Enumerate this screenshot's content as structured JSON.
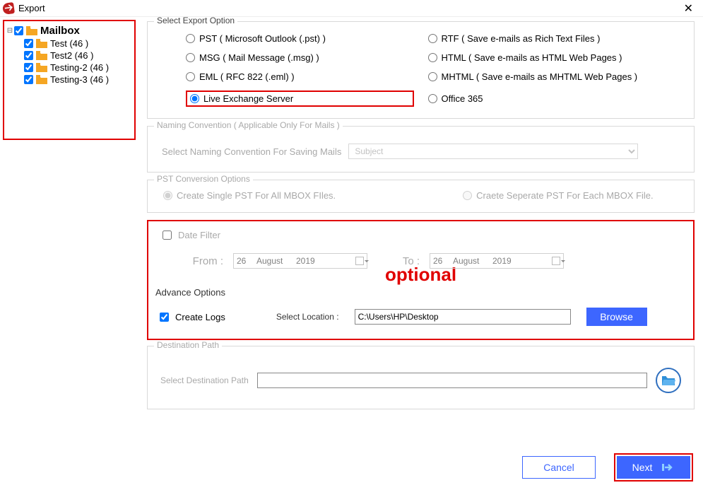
{
  "window": {
    "title": "Export",
    "close": "✕"
  },
  "tree": {
    "root_label": "Mailbox",
    "items": [
      {
        "label": "Test (46 )"
      },
      {
        "label": "Test2 (46 )"
      },
      {
        "label": "Testing-2 (46 )"
      },
      {
        "label": "Testing-3 (46 )"
      }
    ]
  },
  "export_options": {
    "title": "Select Export Option",
    "selected": "live_exchange",
    "opts": {
      "pst": "PST ( Microsoft Outlook (.pst) )",
      "rtf": "RTF ( Save e-mails as Rich Text Files )",
      "msg": "MSG ( Mail Message (.msg) )",
      "html": "HTML ( Save e-mails as HTML Web Pages )",
      "eml": "EML ( RFC 822 (.eml) )",
      "mhtml": "MHTML ( Save e-mails as MHTML Web Pages )",
      "live": "Live Exchange Server",
      "o365": "Office 365"
    }
  },
  "naming": {
    "title": "Naming Convention ( Applicable Only For Mails )",
    "label": "Select Naming Convention For Saving Mails",
    "value": "Subject"
  },
  "pst_conv": {
    "title": "PST Conversion Options",
    "single": "Create Single PST For All MBOX FIles.",
    "separate": "Craete Seperate PST  For Each MBOX File."
  },
  "optional_text": "optional",
  "date_filter": {
    "title": "Date Filter",
    "from_label": "From :",
    "to_label": "To :",
    "from": {
      "d": "26",
      "m": "August",
      "y": "2019"
    },
    "to": {
      "d": "26",
      "m": "August",
      "y": "2019"
    }
  },
  "advance": {
    "title": "Advance Options",
    "create_logs": "Create Logs",
    "location_label": "Select Location :",
    "location_value": "C:\\Users\\HP\\Desktop",
    "browse": "Browse"
  },
  "destination": {
    "title": "Destination Path",
    "label": "Select Destination Path",
    "value": ""
  },
  "footer": {
    "cancel": "Cancel",
    "next": "Next"
  }
}
